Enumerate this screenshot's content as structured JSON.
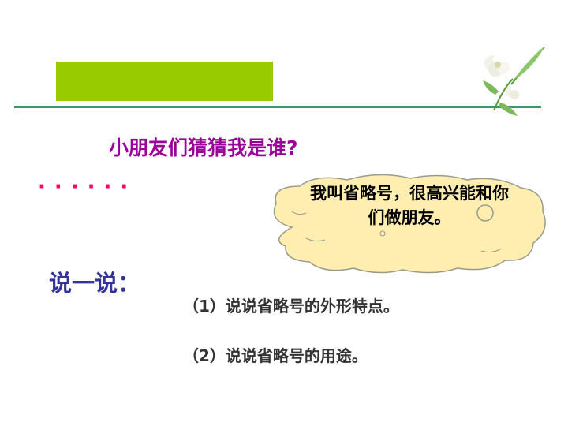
{
  "slide": {
    "question": "小朋友们猜猜我是谁?",
    "dots": "······",
    "bubble_line1": "我叫省略号，很高兴能和你",
    "bubble_line2": "们做朋友。",
    "say_title": "说一说：",
    "task1": "（1）说说省略号的外形特点。",
    "task2": "（2）说说省略号的用途。"
  },
  "colors": {
    "title_bar": "#99cc00",
    "rule": "#339966",
    "question": "#990099",
    "dots": "#ff0066",
    "say_title": "#333399",
    "cloud_fill": "#ffeeb0"
  },
  "icons": [
    "flower-decoration-icon",
    "speech-cloud-icon"
  ]
}
